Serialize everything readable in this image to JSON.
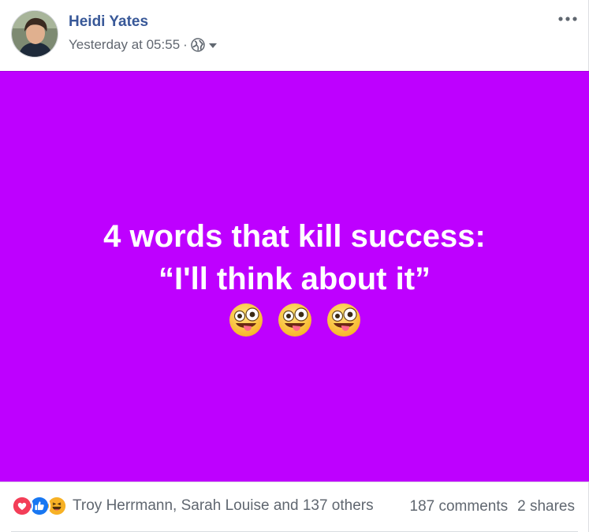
{
  "post": {
    "author": "Heidi Yates",
    "timestamp": "Yesterday at 05:55",
    "separator": "·",
    "privacy_icon": "globe-icon",
    "background_color": "#be00ff",
    "text_line1": "4 words that kill success:",
    "text_line2": "“I'll think about it”",
    "emojis": [
      "zany-face-emoji",
      "zany-face-emoji",
      "zany-face-emoji"
    ]
  },
  "reactions": {
    "icons": [
      "love-icon",
      "like-icon",
      "haha-icon"
    ],
    "names": "Troy Herrmann, Sarah Louise and 137 others",
    "comments": "187 comments",
    "shares": "2 shares"
  },
  "colors": {
    "author_link": "#385898",
    "meta_text": "#616770",
    "love": "#f33e58",
    "like": "#1877f2",
    "haha": "#f7b125"
  }
}
